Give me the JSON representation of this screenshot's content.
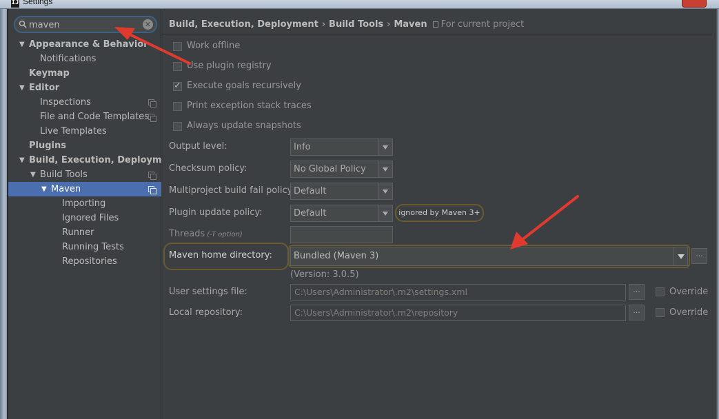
{
  "window": {
    "title": "Settings",
    "app_icon": "IJ"
  },
  "search": {
    "value": "maven",
    "placeholder": ""
  },
  "tree": [
    {
      "label": "Appearance & Behavior",
      "level": 0,
      "bold": true,
      "expanded": true,
      "copy_icon": false,
      "selected": false
    },
    {
      "label": "Notifications",
      "level": 2,
      "bold": false,
      "copy_icon": false,
      "selected": false
    },
    {
      "label": "Keymap",
      "level": 1,
      "bold": true,
      "copy_icon": false,
      "selected": false
    },
    {
      "label": "Editor",
      "level": 0,
      "bold": true,
      "expanded": true,
      "copy_icon": false,
      "selected": false
    },
    {
      "label": "Inspections",
      "level": 2,
      "bold": false,
      "copy_icon": true,
      "selected": false
    },
    {
      "label": "File and Code Templates",
      "level": 2,
      "bold": false,
      "copy_icon": true,
      "selected": false
    },
    {
      "label": "Live Templates",
      "level": 2,
      "bold": false,
      "copy_icon": false,
      "selected": false
    },
    {
      "label": "Plugins",
      "level": 1,
      "bold": true,
      "copy_icon": false,
      "selected": false
    },
    {
      "label": "Build, Execution, Deployment",
      "level": 0,
      "bold": true,
      "expanded": true,
      "copy_icon": false,
      "selected": false
    },
    {
      "label": "Build Tools",
      "level": 2,
      "bold": false,
      "expanded": true,
      "copy_icon": true,
      "selected": false
    },
    {
      "label": "Maven",
      "level": 3,
      "bold": false,
      "expanded": true,
      "copy_icon": true,
      "selected": true
    },
    {
      "label": "Importing",
      "level": 4,
      "bold": false,
      "copy_icon": false,
      "selected": false
    },
    {
      "label": "Ignored Files",
      "level": 4,
      "bold": false,
      "copy_icon": false,
      "selected": false
    },
    {
      "label": "Runner",
      "level": 4,
      "bold": false,
      "copy_icon": false,
      "selected": false
    },
    {
      "label": "Running Tests",
      "level": 4,
      "bold": false,
      "copy_icon": false,
      "selected": false
    },
    {
      "label": "Repositories",
      "level": 4,
      "bold": false,
      "copy_icon": false,
      "selected": false
    }
  ],
  "breadcrumb": {
    "items": [
      "Build, Execution, Deployment",
      "Build Tools",
      "Maven"
    ],
    "separator": "›",
    "scope": "For current project"
  },
  "checkboxes": [
    {
      "label": "Work offline",
      "checked": false
    },
    {
      "label": "Use plugin registry",
      "checked": false
    },
    {
      "label": "Execute goals recursively",
      "checked": true
    },
    {
      "label": "Print exception stack traces",
      "checked": false
    },
    {
      "label": "Always update snapshots",
      "checked": false
    }
  ],
  "form": {
    "output_level": {
      "label": "Output level:",
      "value": "Info"
    },
    "checksum_policy": {
      "label": "Checksum policy:",
      "value": "No Global Policy"
    },
    "fail_policy": {
      "label": "Multiproject build fail policy:",
      "value": "Default"
    },
    "plugin_update": {
      "label": "Plugin update policy:",
      "value": "Default",
      "note": "ignored by Maven 3+"
    },
    "threads": {
      "label": "Threads",
      "hint": "(-T option)",
      "value": ""
    },
    "maven_home": {
      "label": "Maven home directory:",
      "value": "Bundled (Maven 3)",
      "version": "(Version: 3.0.5)"
    },
    "user_settings": {
      "label": "User settings file:",
      "value": "C:\\Users\\Administrator\\.m2\\settings.xml",
      "override_label": "Override",
      "override": false
    },
    "local_repo": {
      "label": "Local repository:",
      "value": "C:\\Users\\Administrator\\.m2\\repository",
      "override_label": "Override",
      "override": false
    }
  },
  "buttons": {
    "ellipsis": "..."
  },
  "colors": {
    "background": "#3c3f41",
    "selection": "#4b6eaf",
    "annotation_arrow": "#e03a2f",
    "highlight_outline": "#6a5a30"
  }
}
